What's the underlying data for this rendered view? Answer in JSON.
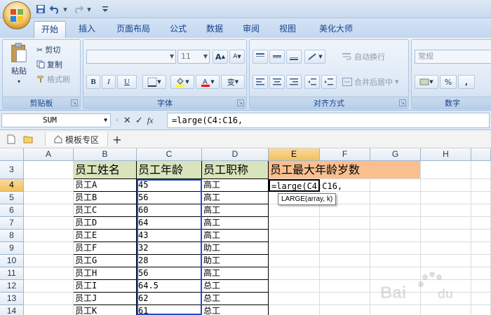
{
  "quick_access": {
    "dropdown_glyph": "▾"
  },
  "tabs": [
    {
      "label": "开始",
      "active": true
    },
    {
      "label": "插入"
    },
    {
      "label": "页面布局"
    },
    {
      "label": "公式"
    },
    {
      "label": "数据"
    },
    {
      "label": "审阅"
    },
    {
      "label": "视图"
    },
    {
      "label": "美化大师"
    }
  ],
  "ribbon": {
    "clipboard": {
      "label": "剪贴板",
      "paste": "粘贴",
      "cut": "剪切",
      "copy": "复制",
      "format_painter": "格式刷"
    },
    "font": {
      "label": "字体",
      "font_name": "",
      "font_size": "11",
      "bold": "B",
      "italic": "I",
      "underline": "U",
      "grow": "A",
      "shrink": "A",
      "phonetic": "变"
    },
    "alignment": {
      "label": "对齐方式",
      "wrap_text": "自动换行",
      "merge_center": "合并后居中"
    },
    "number": {
      "label": "数字",
      "format": "常规",
      "percent": "%",
      "comma": ","
    }
  },
  "formula_bar": {
    "name_box": "SUM",
    "cancel": "✕",
    "enter": "✓",
    "fx": "fx",
    "formula": "=large(C4:C16,"
  },
  "sheet_tabs": {
    "template_zone": "模板专区",
    "add": "+"
  },
  "columns": [
    "A",
    "B",
    "C",
    "D",
    "E",
    "F",
    "G",
    "H"
  ],
  "rows": [
    "3",
    "4",
    "5",
    "6",
    "7",
    "8",
    "9",
    "10",
    "11",
    "12",
    "13",
    "14"
  ],
  "table": {
    "headers": [
      "员工姓名",
      "员工年龄",
      "员工职称"
    ],
    "data": [
      [
        "员工A",
        "45",
        "高工"
      ],
      [
        "员工B",
        "56",
        "高工"
      ],
      [
        "员工C",
        "60",
        "高工"
      ],
      [
        "员工D",
        "64",
        "高工"
      ],
      [
        "员工E",
        "43",
        "高工"
      ],
      [
        "员工F",
        "32",
        "助工"
      ],
      [
        "员工G",
        "28",
        "助工"
      ],
      [
        "员工H",
        "56",
        "高工"
      ],
      [
        "员工I",
        "64.5",
        "总工"
      ],
      [
        "员工J",
        "62",
        "总工"
      ],
      [
        "员工K",
        "61",
        "总工"
      ]
    ]
  },
  "e3_title": "员工最大年龄岁数",
  "active_cell_text": "=large(C4:C16,",
  "tooltip": "LARGE(array, k)",
  "colors": {
    "header_green": "#d8e4bc",
    "title_orange": "#fabf8f",
    "selection": "#f1c15f"
  }
}
